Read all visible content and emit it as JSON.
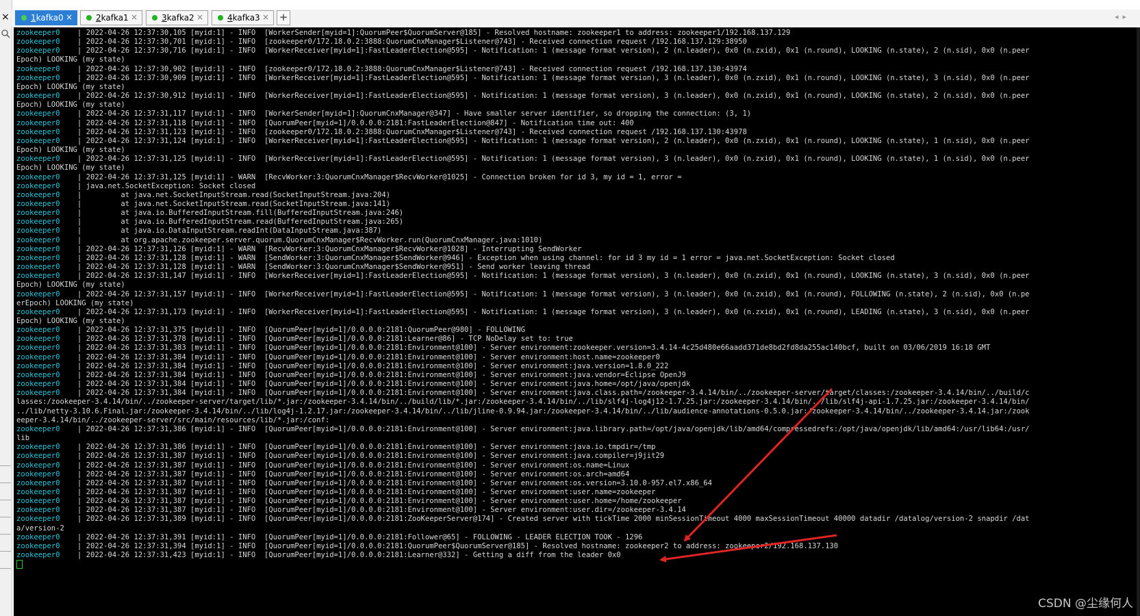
{
  "tabs": [
    {
      "number": "1",
      "name": "kafka0",
      "active": true
    },
    {
      "number": "2",
      "name": "kafka1",
      "active": false
    },
    {
      "number": "3",
      "name": "kafka2",
      "active": false
    },
    {
      "number": "4",
      "name": "kafka3",
      "active": false
    }
  ],
  "chrome": {
    "close_glyph": "×",
    "add_tab_glyph": "+",
    "nav_left": "◂",
    "nav_right": "▸",
    "tab_close_glyph": "×"
  },
  "terminal": {
    "lines": [
      [
        "zookeeper0",
        "2022-04-26 12:37:30,105 [myid:1] - INFO  [WorkerSender[myid=1]:QuorumPeer$QuorumServer@185] - Resolved hostname: zookeeper1 to address: zookeeper1/192.168.137.129"
      ],
      [
        "zookeeper0",
        "2022-04-26 12:37:30,701 [myid:1] - INFO  [zookeeper0/172.18.0.2:3888:QuorumCnxManager$Listener@743] - Received connection request /192.168.137.129:38950"
      ],
      [
        "zookeeper0",
        "2022-04-26 12:37:30,716 [myid:1] - INFO  [WorkerReceiver[myid=1]:FastLeaderElection@595] - Notification: 1 (message format version), 2 (n.leader), 0x0 (n.zxid), 0x1 (n.round), LOOKING (n.state), 2 (n.sid), 0x0 (n.peer"
      ],
      [
        "",
        "Epoch) LOOKING (my state)"
      ],
      [
        "zookeeper0",
        "2022-04-26 12:37:30,902 [myid:1] - INFO  [zookeeper0/172.18.0.2:3888:QuorumCnxManager$Listener@743] - Received connection request /192.168.137.130:43974"
      ],
      [
        "zookeeper0",
        "2022-04-26 12:37:30,909 [myid:1] - INFO  [WorkerReceiver[myid=1]:FastLeaderElection@595] - Notification: 1 (message format version), 3 (n.leader), 0x0 (n.zxid), 0x1 (n.round), LOOKING (n.state), 3 (n.sid), 0x0 (n.peer"
      ],
      [
        "",
        "Epoch) LOOKING (my state)"
      ],
      [
        "zookeeper0",
        "2022-04-26 12:37:30,912 [myid:1] - INFO  [WorkerReceiver[myid=1]:FastLeaderElection@595] - Notification: 1 (message format version), 3 (n.leader), 0x0 (n.zxid), 0x1 (n.round), LOOKING (n.state), 2 (n.sid), 0x0 (n.peer"
      ],
      [
        "",
        "Epoch) LOOKING (my state)"
      ],
      [
        "zookeeper0",
        "2022-04-26 12:37:31,117 [myid:1] - INFO  [WorkerSender[myid=1]:QuorumCnxManager@347] - Have smaller server identifier, so dropping the connection: (3, 1)"
      ],
      [
        "zookeeper0",
        "2022-04-26 12:37:31,118 [myid:1] - INFO  [QuorumPeer[myid=1]/0.0.0.0:2181:FastLeaderElection@847] - Notification time out: 400"
      ],
      [
        "zookeeper0",
        "2022-04-26 12:37:31,123 [myid:1] - INFO  [zookeeper0/172.18.0.2:3888:QuorumCnxManager$Listener@743] - Received connection request /192.168.137.130:43978"
      ],
      [
        "zookeeper0",
        "2022-04-26 12:37:31,124 [myid:1] - INFO  [WorkerReceiver[myid=1]:FastLeaderElection@595] - Notification: 1 (message format version), 2 (n.leader), 0x0 (n.zxid), 0x1 (n.round), LOOKING (n.state), 1 (n.sid), 0x0 (n.peer"
      ],
      [
        "",
        "Epoch) LOOKING (my state)"
      ],
      [
        "zookeeper0",
        "2022-04-26 12:37:31,125 [myid:1] - INFO  [WorkerReceiver[myid=1]:FastLeaderElection@595] - Notification: 1 (message format version), 3 (n.leader), 0x0 (n.zxid), 0x1 (n.round), LOOKING (n.state), 1 (n.sid), 0x0 (n.peer"
      ],
      [
        "",
        "Epoch) LOOKING (my state)"
      ],
      [
        "zookeeper0",
        "2022-04-26 12:37:31,125 [myid:1] - WARN  [RecvWorker:3:QuorumCnxManager$RecvWorker@1025] - Connection broken for id 3, my id = 1, error ="
      ],
      [
        "zookeeper0",
        "java.net.SocketException: Socket closed"
      ],
      [
        "zookeeper0",
        "        at java.net.SocketInputStream.read(SocketInputStream.java:204)"
      ],
      [
        "zookeeper0",
        "        at java.net.SocketInputStream.read(SocketInputStream.java:141)"
      ],
      [
        "zookeeper0",
        "        at java.io.BufferedInputStream.fill(BufferedInputStream.java:246)"
      ],
      [
        "zookeeper0",
        "        at java.io.BufferedInputStream.read(BufferedInputStream.java:265)"
      ],
      [
        "zookeeper0",
        "        at java.io.DataInputStream.readInt(DataInputStream.java:387)"
      ],
      [
        "zookeeper0",
        "        at org.apache.zookeeper.server.quorum.QuorumCnxManager$RecvWorker.run(QuorumCnxManager.java:1010)"
      ],
      [
        "zookeeper0",
        "2022-04-26 12:37:31,126 [myid:1] - WARN  [RecvWorker:3:QuorumCnxManager$RecvWorker@1028] - Interrupting SendWorker"
      ],
      [
        "zookeeper0",
        "2022-04-26 12:37:31,128 [myid:1] - WARN  [SendWorker:3:QuorumCnxManager$SendWorker@946] - Exception when using channel: for id 3 my id = 1 error = java.net.SocketException: Socket closed"
      ],
      [
        "zookeeper0",
        "2022-04-26 12:37:31,128 [myid:1] - WARN  [SendWorker:3:QuorumCnxManager$SendWorker@951] - Send worker leaving thread"
      ],
      [
        "zookeeper0",
        "2022-04-26 12:37:31,147 [myid:1] - INFO  [WorkerReceiver[myid=1]:FastLeaderElection@595] - Notification: 1 (message format version), 3 (n.leader), 0x0 (n.zxid), 0x1 (n.round), LOOKING (n.state), 3 (n.sid), 0x0 (n.peer"
      ],
      [
        "",
        "Epoch) LOOKING (my state)"
      ],
      [
        "zookeeper0",
        "2022-04-26 12:37:31,157 [myid:1] - INFO  [WorkerReceiver[myid=1]:FastLeaderElection@595] - Notification: 1 (message format version), 3 (n.leader), 0x0 (n.zxid), 0x1 (n.round), FOLLOWING (n.state), 2 (n.sid), 0x0 (n.pe"
      ],
      [
        "",
        "erEpoch) LOOKING (my state)"
      ],
      [
        "zookeeper0",
        "2022-04-26 12:37:31,173 [myid:1] - INFO  [WorkerReceiver[myid=1]:FastLeaderElection@595] - Notification: 1 (message format version), 3 (n.leader), 0x0 (n.zxid), 0x1 (n.round), LEADING (n.state), 3 (n.sid), 0x0 (n.peer"
      ],
      [
        "",
        "Epoch) LOOKING (my state)"
      ],
      [
        "zookeeper0",
        "2022-04-26 12:37:31,375 [myid:1] - INFO  [QuorumPeer[myid=1]/0.0.0.0:2181:QuorumPeer@980] - FOLLOWING"
      ],
      [
        "zookeeper0",
        "2022-04-26 12:37:31,378 [myid:1] - INFO  [QuorumPeer[myid=1]/0.0.0.0:2181:Learner@86] - TCP NoDelay set to: true"
      ],
      [
        "zookeeper0",
        "2022-04-26 12:37:31,383 [myid:1] - INFO  [QuorumPeer[myid=1]/0.0.0.0:2181:Environment@100] - Server environment:zookeeper.version=3.4.14-4c25d480e66aadd371de8bd2fd8da255ac140bcf, built on 03/06/2019 16:18 GMT"
      ],
      [
        "zookeeper0",
        "2022-04-26 12:37:31,384 [myid:1] - INFO  [QuorumPeer[myid=1]/0.0.0.0:2181:Environment@100] - Server environment:host.name=zookeeper0"
      ],
      [
        "zookeeper0",
        "2022-04-26 12:37:31,384 [myid:1] - INFO  [QuorumPeer[myid=1]/0.0.0.0:2181:Environment@100] - Server environment:java.version=1.8.0_222"
      ],
      [
        "zookeeper0",
        "2022-04-26 12:37:31,384 [myid:1] - INFO  [QuorumPeer[myid=1]/0.0.0.0:2181:Environment@100] - Server environment:java.vendor=Eclipse OpenJ9"
      ],
      [
        "zookeeper0",
        "2022-04-26 12:37:31,384 [myid:1] - INFO  [QuorumPeer[myid=1]/0.0.0.0:2181:Environment@100] - Server environment:java.home=/opt/java/openjdk"
      ],
      [
        "zookeeper0",
        "2022-04-26 12:37:31,384 [myid:1] - INFO  [QuorumPeer[myid=1]/0.0.0.0:2181:Environment@100] - Server environment:java.class.path=/zookeeper-3.4.14/bin/../zookeeper-server/target/classes:/zookeeper-3.4.14/bin/../build/c"
      ],
      [
        "",
        "lasses:/zookeeper-3.4.14/bin/../zookeeper-server/target/lib/*.jar:/zookeeper-3.4.14/bin/../build/lib/*.jar:/zookeeper-3.4.14/bin/../lib/slf4j-log4j12-1.7.25.jar:/zookeeper-3.4.14/bin/../lib/slf4j-api-1.7.25.jar:/zookeeper-3.4.14/bin/"
      ],
      [
        "",
        "../lib/netty-3.10.6.Final.jar:/zookeeper-3.4.14/bin/../lib/log4j-1.2.17.jar:/zookeeper-3.4.14/bin/../lib/jline-0.9.94.jar:/zookeeper-3.4.14/bin/../lib/audience-annotations-0.5.0.jar:/zookeeper-3.4.14/bin/../zookeeper-3.4.14.jar:/zook"
      ],
      [
        "",
        "eeper-3.4.14/bin/../zookeeper-server/src/main/resources/lib/*.jar:/conf:"
      ],
      [
        "zookeeper0",
        "2022-04-26 12:37:31,386 [myid:1] - INFO  [QuorumPeer[myid=1]/0.0.0.0:2181:Environment@100] - Server environment:java.library.path=/opt/java/openjdk/lib/amd64/compressedrefs:/opt/java/openjdk/lib/amd64:/usr/lib64:/usr/"
      ],
      [
        "",
        "lib"
      ],
      [
        "zookeeper0",
        "2022-04-26 12:37:31,386 [myid:1] - INFO  [QuorumPeer[myid=1]/0.0.0.0:2181:Environment@100] - Server environment:java.io.tmpdir=/tmp"
      ],
      [
        "zookeeper0",
        "2022-04-26 12:37:31,387 [myid:1] - INFO  [QuorumPeer[myid=1]/0.0.0.0:2181:Environment@100] - Server environment:java.compiler=j9jit29"
      ],
      [
        "zookeeper0",
        "2022-04-26 12:37:31,387 [myid:1] - INFO  [QuorumPeer[myid=1]/0.0.0.0:2181:Environment@100] - Server environment:os.name=Linux"
      ],
      [
        "zookeeper0",
        "2022-04-26 12:37:31,387 [myid:1] - INFO  [QuorumPeer[myid=1]/0.0.0.0:2181:Environment@100] - Server environment:os.arch=amd64"
      ],
      [
        "zookeeper0",
        "2022-04-26 12:37:31,387 [myid:1] - INFO  [QuorumPeer[myid=1]/0.0.0.0:2181:Environment@100] - Server environment:os.version=3.10.0-957.el7.x86_64"
      ],
      [
        "zookeeper0",
        "2022-04-26 12:37:31,387 [myid:1] - INFO  [QuorumPeer[myid=1]/0.0.0.0:2181:Environment@100] - Server environment:user.name=zookeeper"
      ],
      [
        "zookeeper0",
        "2022-04-26 12:37:31,387 [myid:1] - INFO  [QuorumPeer[myid=1]/0.0.0.0:2181:Environment@100] - Server environment:user.home=/home/zookeeper"
      ],
      [
        "zookeeper0",
        "2022-04-26 12:37:31,387 [myid:1] - INFO  [QuorumPeer[myid=1]/0.0.0.0:2181:Environment@100] - Server environment:user.dir=/zookeeper-3.4.14"
      ],
      [
        "zookeeper0",
        "2022-04-26 12:37:31,389 [myid:1] - INFO  [QuorumPeer[myid=1]/0.0.0.0:2181:ZooKeeperServer@174] - Created server with tickTime 2000 minSessionTimeout 4000 maxSessionTimeout 40000 datadir /datalog/version-2 snapdir /dat"
      ],
      [
        "",
        "a/version-2"
      ],
      [
        "zookeeper0",
        "2022-04-26 12:37:31,391 [myid:1] - INFO  [QuorumPeer[myid=1]/0.0.0.0:2181:Follower@65] - FOLLOWING - LEADER ELECTION TOOK - 1296"
      ],
      [
        "zookeeper0",
        "2022-04-26 12:37:31,394 [myid:1] - INFO  [QuorumPeer[myid=1]/0.0.0.0:2181:QuorumPeer$QuorumServer@185] - Resolved hostname: zookeeper2 to address: zookeeper2/192.168.137.130"
      ],
      [
        "zookeeper0",
        "2022-04-26 12:37:31,423 [myid:1] - INFO  [QuorumPeer[myid=1]/0.0.0.0:2181:Learner@332] - Getting a diff from the leader 0x0"
      ]
    ],
    "separator": "|"
  },
  "watermark": "CSDN @尘缘何人",
  "colors": {
    "terminal_bg": "#000000",
    "tag": "#26c6da",
    "text": "#d8d8d8",
    "cursor": "#28d228",
    "arrow": "#e02424",
    "active_tab": "#2a7fd4"
  }
}
